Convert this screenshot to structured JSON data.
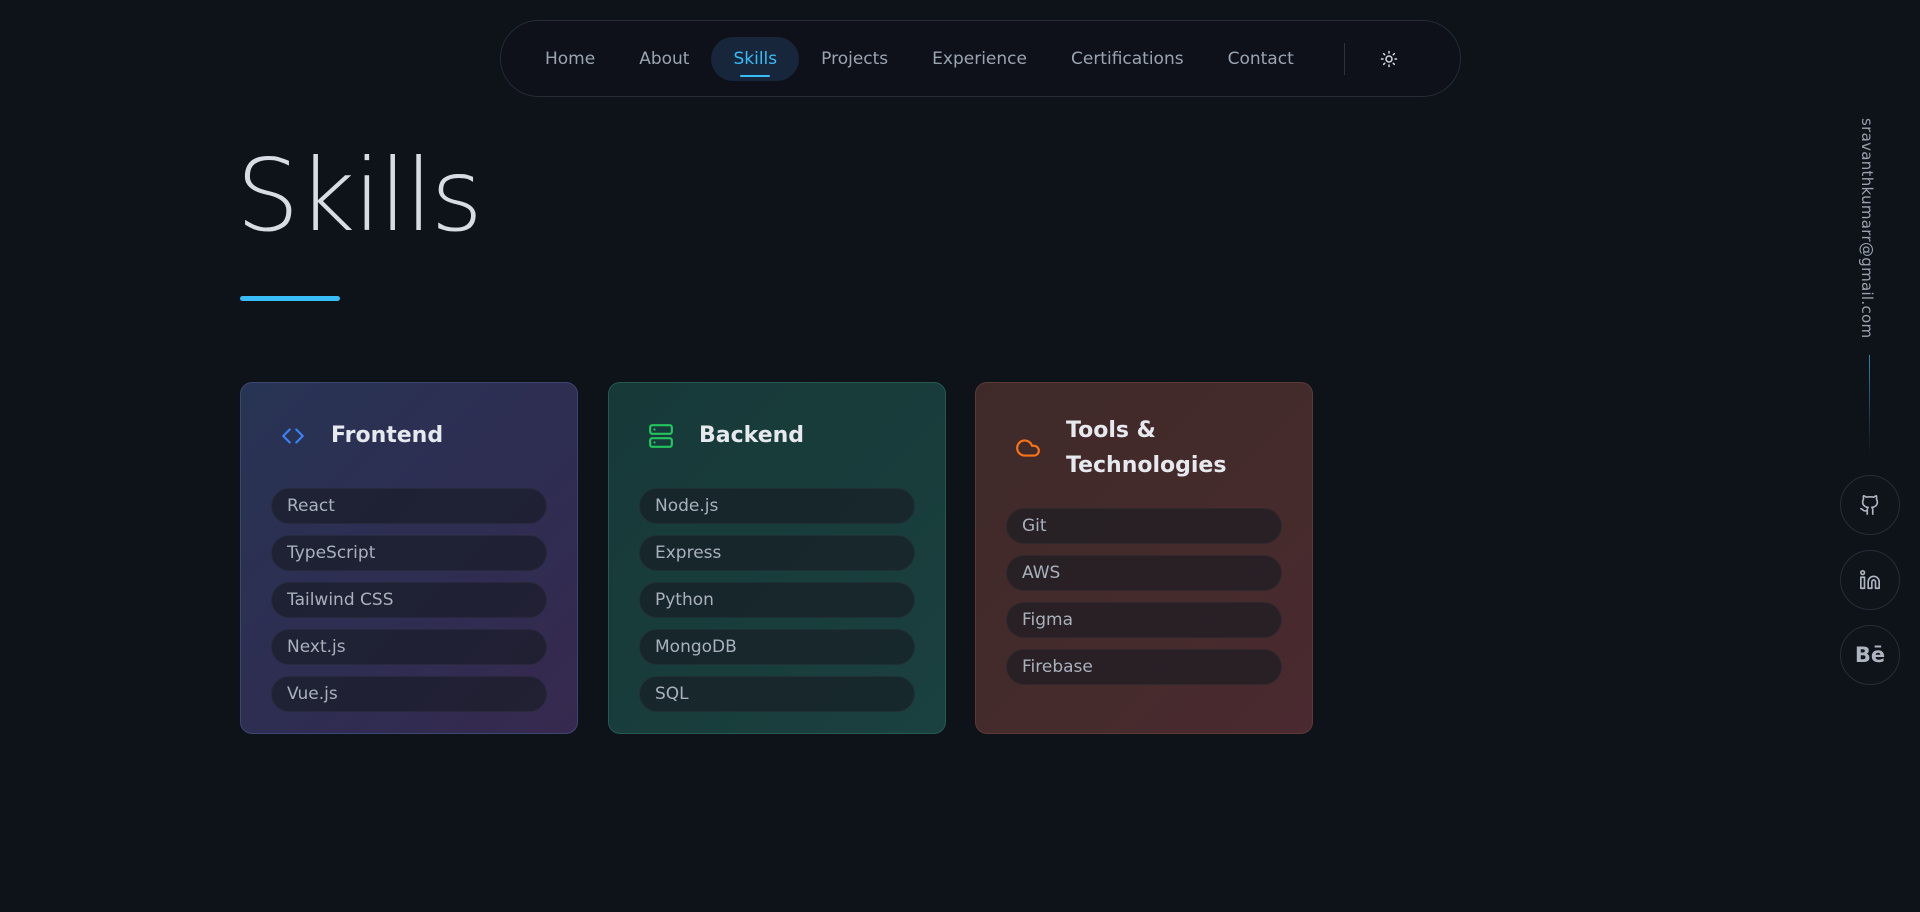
{
  "nav": {
    "items": [
      {
        "label": "Home"
      },
      {
        "label": "About"
      },
      {
        "label": "Skills"
      },
      {
        "label": "Projects"
      },
      {
        "label": "Experience"
      },
      {
        "label": "Certifications"
      },
      {
        "label": "Contact"
      }
    ],
    "active": "Skills",
    "theme_icon": "sun-icon"
  },
  "page": {
    "title": "Skills",
    "accent_color": "#38bdf8",
    "background_color": "#0e1219"
  },
  "cards": [
    {
      "title": "Frontend",
      "icon": "code-icon",
      "icon_color": "#3b82f6",
      "skills": [
        "React",
        "TypeScript",
        "Tailwind CSS",
        "Next.js",
        "Vue.js"
      ]
    },
    {
      "title": "Backend",
      "icon": "server-icon",
      "icon_color": "#22c55e",
      "skills": [
        "Node.js",
        "Express",
        "Python",
        "MongoDB",
        "SQL"
      ]
    },
    {
      "title": "Tools & Technologies",
      "icon": "cloud-icon",
      "icon_color": "#f97316",
      "skills": [
        "Git",
        "AWS",
        "Figma",
        "Firebase"
      ]
    }
  ],
  "sidebar": {
    "email": "sravanthkumarr@gmail.com",
    "socials": [
      {
        "icon": "github-icon"
      },
      {
        "icon": "linkedin-icon"
      },
      {
        "icon": "behance-icon",
        "label": "Bē"
      }
    ]
  }
}
